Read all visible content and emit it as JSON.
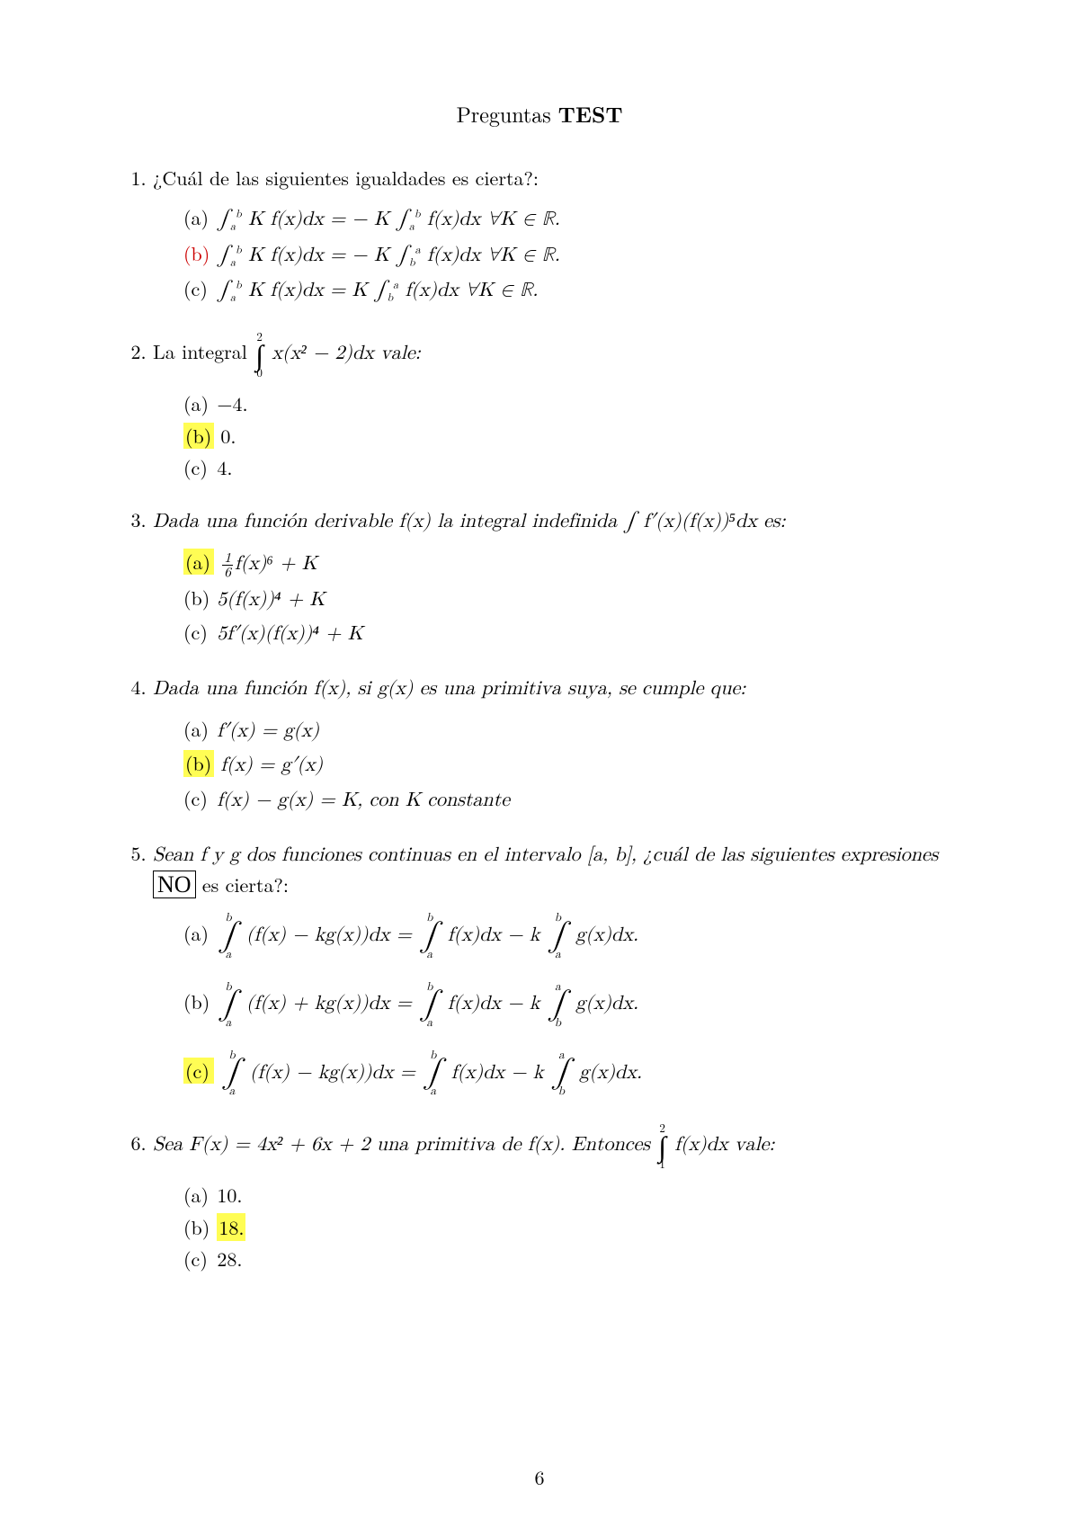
{
  "title_plain": "Preguntas ",
  "title_bold": "TEST",
  "page_number": "6",
  "questions": {
    "q1": {
      "text": "¿Cuál de las siguientes igualdades es cierta?:",
      "a_label": "(a)",
      "a_body1": "∫",
      "a_body2": " K f(x)dx = − K ∫",
      "a_body3": " f(x)dx    ∀K ∈ ℝ.",
      "a_sup1": "b",
      "a_sub1": "a",
      "a_sup2": "b",
      "a_sub2": "a",
      "b_label": "(b)",
      "b_body1": "∫",
      "b_body2": " K f(x)dx = − K ∫",
      "b_body3": " f(x)dx    ∀K ∈ ℝ.",
      "b_sup1": "b",
      "b_sub1": "a",
      "b_sup2": "a",
      "b_sub2": "b",
      "c_label": "(c)",
      "c_body1": "∫",
      "c_body2": " K f(x)dx = K ∫",
      "c_body3": " f(x)dx    ∀K ∈ ℝ.",
      "c_sup1": "b",
      "c_sub1": "a",
      "c_sup2": "a",
      "c_sub2": "b"
    },
    "q2": {
      "text_a": "La integral ",
      "int_sup": "2",
      "int_sub": "0",
      "text_b": " x(x² − 2)dx vale:",
      "a_label": "(a)",
      "a_body": " −4.",
      "b_label": "(b)",
      "b_body": " 0.",
      "c_label": "(c)",
      "c_body": " 4."
    },
    "q3": {
      "text": "Dada una función derivable f(x) la integral indefinida ∫ f′(x)(f(x))⁵dx es:",
      "a_label": "(a)",
      "a_num": "1",
      "a_den": "6",
      "a_body": "f(x)⁶ + K",
      "b_label": "(b)",
      "b_body": " 5(f(x))⁴ + K",
      "c_label": "(c)",
      "c_body": " 5f′(x)(f(x))⁴ + K"
    },
    "q4": {
      "text": "Dada una función f(x), si g(x) es una primitiva suya, se cumple que:",
      "a_label": "(a)",
      "a_body": " f′(x) = g(x)",
      "b_label": "(b)",
      "b_body": " f(x) = g′(x)",
      "c_label": "(c)",
      "c_body": " f(x) − g(x) = K, con K constante"
    },
    "q5": {
      "text_a": "Sean f y g dos funciones continuas en el intervalo [a, b], ¿cuál de las siguientes expresiones ",
      "no_box": "NO",
      "text_b": " es cierta?:",
      "a_label": "(a)",
      "a_body": " (f(x) − kg(x))dx = ",
      "a_body2": " f(x)dx − k ",
      "a_body3": " g(x)dx.",
      "a_sup1": "b",
      "a_sub1": "a",
      "a_sup2": "b",
      "a_sub2": "a",
      "a_sup3": "b",
      "a_sub3": "a",
      "b_label": "(b)",
      "b_body": " (f(x) + kg(x))dx = ",
      "b_body2": " f(x)dx − k ",
      "b_body3": " g(x)dx.",
      "b_sup1": "b",
      "b_sub1": "a",
      "b_sup2": "b",
      "b_sub2": "a",
      "b_sup3": "a",
      "b_sub3": "b",
      "c_label": "(c)",
      "c_body": " (f(x) − kg(x))dx = ",
      "c_body2": " f(x)dx − k ",
      "c_body3": " g(x)dx.",
      "c_sup1": "b",
      "c_sub1": "a",
      "c_sup2": "b",
      "c_sub2": "a",
      "c_sup3": "a",
      "c_sub3": "b"
    },
    "q6": {
      "text_a": "Sea F(x) = 4x² + 6x + 2 una primitiva de f(x). Entonces ",
      "int_sup": "2",
      "int_sub": "1",
      "text_b": " f(x)dx vale:",
      "a_label": "(a)",
      "a_body": " 10.",
      "b_label": "(b)",
      "b_body": "18.",
      "c_label": "(c)",
      "c_body": " 28."
    }
  }
}
